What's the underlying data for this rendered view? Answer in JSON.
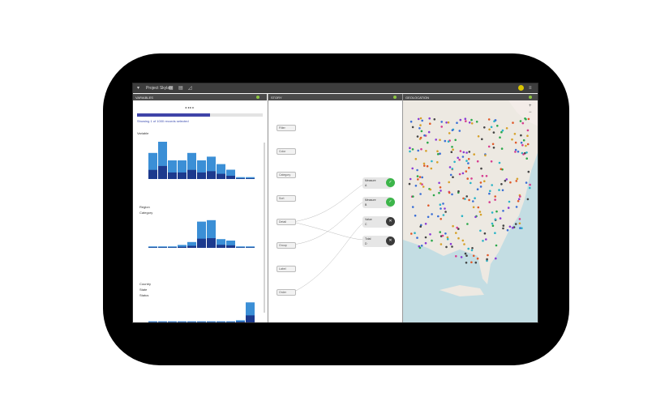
{
  "app": {
    "title": "Project Skylab",
    "accent": "#1e73be"
  },
  "panels": {
    "vars": {
      "title": "VARIABLES"
    },
    "story": {
      "title": "STORY"
    },
    "map": {
      "title": "GEOLOCATION"
    }
  },
  "variables": {
    "progress_text": "Showing 1 of 1000 records selected",
    "sections": [
      {
        "label": "Variable",
        "values": [
          0.7,
          1,
          0.5,
          0.5,
          0.7,
          0.5,
          0.6,
          0.4,
          0.25,
          0.05,
          0.05
        ]
      },
      {
        "label": "Category",
        "values": [
          0.05,
          0.05,
          0.05,
          0.1,
          0.2,
          0.9,
          0.95,
          0.3,
          0.25,
          0.05,
          0.05
        ]
      },
      {
        "label": "Status",
        "values": [
          0.05,
          0.05,
          0.05,
          0.05,
          0.05,
          0.05,
          0.05,
          0.05,
          0.05,
          0.1,
          0.95
        ]
      }
    ],
    "rows": [
      "Region",
      "Country",
      "State",
      "Type"
    ]
  },
  "story": {
    "items": [
      "Filter",
      "Color",
      "Category",
      "Sort",
      "Detail",
      "Group",
      "Label",
      "Order"
    ],
    "cards": [
      {
        "title": "Measure",
        "sub": "A",
        "status": "ok"
      },
      {
        "title": "Measure",
        "sub": "B",
        "status": "ok"
      },
      {
        "title": "Value",
        "sub": "C",
        "status": "dark"
      },
      {
        "title": "Total",
        "sub": "D",
        "status": "dark"
      }
    ]
  },
  "colors": {
    "bar_light": "#3b8fd6",
    "bar_dark": "#1c3a8e",
    "ok": "#3cb54a",
    "dark": "#3a3a3a",
    "land": "#ede9e2",
    "water": "#c3dde3"
  }
}
